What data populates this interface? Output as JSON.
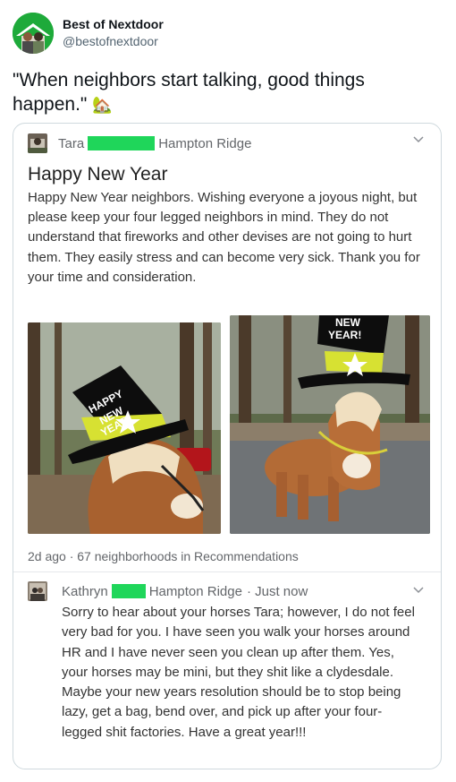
{
  "tweet": {
    "display_name": "Best of Nextdoor",
    "handle": "@bestofnextdoor",
    "text": "\"When neighbors start talking, good things happen.\"",
    "emoji": "🏡"
  },
  "post": {
    "author": "Tara",
    "neighborhood": "Hampton Ridge",
    "title": "Happy New Year",
    "body": "Happy New Year neighbors. Wishing everyone a joyous night, but please keep your four legged neighbors in mind. They do not understand that fireworks and other devises are not going to hurt them. They easily stress and can become very sick. Thank you for your time and consideration.",
    "photo_left_hat_text": "HAPPY NEW YEAR!",
    "photo_right_hat_text": "NEW YEAR!",
    "meta": "2d ago · 67 neighborhoods in Recommendations"
  },
  "reply": {
    "author": "Kathryn",
    "neighborhood": "Hampton Ridge",
    "time": "· Just now",
    "body": "Sorry to hear about your horses Tara; however, I do not feel very bad for you. I have seen you walk your horses around HR and I have never seen you clean up after them. Yes, your horses may be mini, but they shit like a clydesdale. Maybe your new years resolution should be to stop being lazy, get a bag, bend over, and pick up after your four-legged shit factories. Have a great year!!!"
  },
  "icons": {
    "post_menu": "chevron-down-icon",
    "reply_menu": "chevron-down-icon",
    "tweet_emoji": "house-with-garden-icon"
  },
  "colors": {
    "redaction": "#1fd65a",
    "avatar_bg": "#1eaa3a",
    "meta_text": "#63666a"
  }
}
